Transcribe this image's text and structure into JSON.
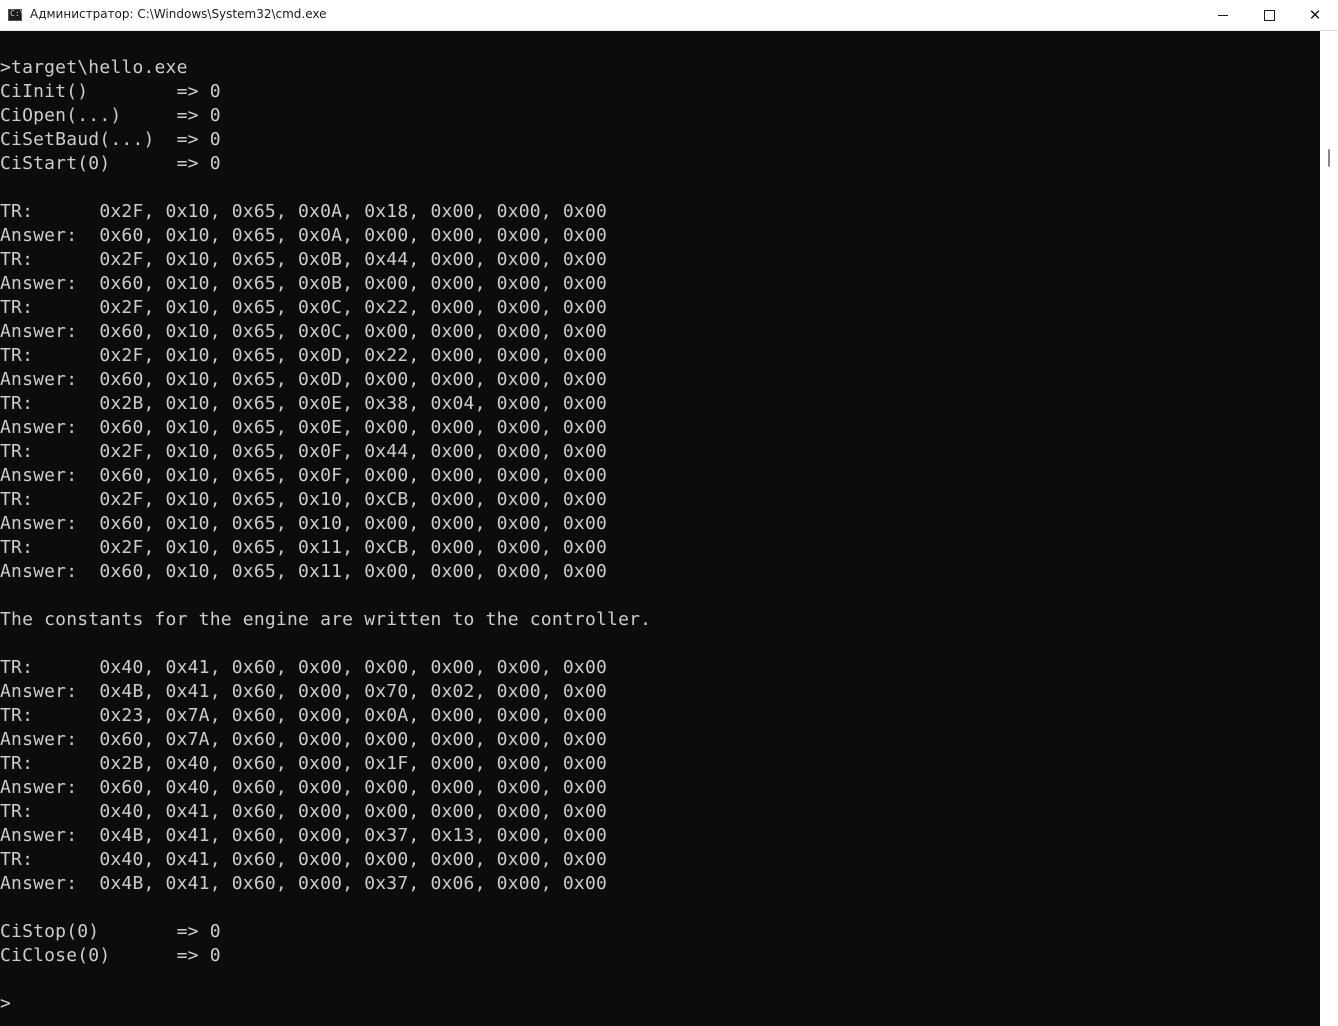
{
  "window": {
    "title": "Администратор: C:\\Windows\\System32\\cmd.exe",
    "app_icon": "cmd-prompt-icon",
    "prompt_glyph": "C:\\",
    "controls": {
      "minimize": "minimize-icon",
      "maximize": "maximize-icon",
      "close": "close-icon",
      "close_glyph": "✕"
    }
  },
  "console": {
    "lines": [
      "",
      ">target\\hello.exe",
      "CiInit()        => 0",
      "CiOpen(...)     => 0",
      "CiSetBaud(...)  => 0",
      "CiStart(0)      => 0",
      "",
      "TR:      0x2F, 0x10, 0x65, 0x0A, 0x18, 0x00, 0x00, 0x00",
      "Answer:  0x60, 0x10, 0x65, 0x0A, 0x00, 0x00, 0x00, 0x00",
      "TR:      0x2F, 0x10, 0x65, 0x0B, 0x44, 0x00, 0x00, 0x00",
      "Answer:  0x60, 0x10, 0x65, 0x0B, 0x00, 0x00, 0x00, 0x00",
      "TR:      0x2F, 0x10, 0x65, 0x0C, 0x22, 0x00, 0x00, 0x00",
      "Answer:  0x60, 0x10, 0x65, 0x0C, 0x00, 0x00, 0x00, 0x00",
      "TR:      0x2F, 0x10, 0x65, 0x0D, 0x22, 0x00, 0x00, 0x00",
      "Answer:  0x60, 0x10, 0x65, 0x0D, 0x00, 0x00, 0x00, 0x00",
      "TR:      0x2B, 0x10, 0x65, 0x0E, 0x38, 0x04, 0x00, 0x00",
      "Answer:  0x60, 0x10, 0x65, 0x0E, 0x00, 0x00, 0x00, 0x00",
      "TR:      0x2F, 0x10, 0x65, 0x0F, 0x44, 0x00, 0x00, 0x00",
      "Answer:  0x60, 0x10, 0x65, 0x0F, 0x00, 0x00, 0x00, 0x00",
      "TR:      0x2F, 0x10, 0x65, 0x10, 0xCB, 0x00, 0x00, 0x00",
      "Answer:  0x60, 0x10, 0x65, 0x10, 0x00, 0x00, 0x00, 0x00",
      "TR:      0x2F, 0x10, 0x65, 0x11, 0xCB, 0x00, 0x00, 0x00",
      "Answer:  0x60, 0x10, 0x65, 0x11, 0x00, 0x00, 0x00, 0x00",
      "",
      "The constants for the engine are written to the controller.",
      "",
      "TR:      0x40, 0x41, 0x60, 0x00, 0x00, 0x00, 0x00, 0x00",
      "Answer:  0x4B, 0x41, 0x60, 0x00, 0x70, 0x02, 0x00, 0x00",
      "TR:      0x23, 0x7A, 0x60, 0x00, 0x0A, 0x00, 0x00, 0x00",
      "Answer:  0x60, 0x7A, 0x60, 0x00, 0x00, 0x00, 0x00, 0x00",
      "TR:      0x2B, 0x40, 0x60, 0x00, 0x1F, 0x00, 0x00, 0x00",
      "Answer:  0x60, 0x40, 0x60, 0x00, 0x00, 0x00, 0x00, 0x00",
      "TR:      0x40, 0x41, 0x60, 0x00, 0x00, 0x00, 0x00, 0x00",
      "Answer:  0x4B, 0x41, 0x60, 0x00, 0x37, 0x13, 0x00, 0x00",
      "TR:      0x40, 0x41, 0x60, 0x00, 0x00, 0x00, 0x00, 0x00",
      "Answer:  0x4B, 0x41, 0x60, 0x00, 0x37, 0x06, 0x00, 0x00",
      "",
      "CiStop(0)       => 0",
      "CiClose(0)      => 0",
      "",
      ">"
    ]
  },
  "colors": {
    "background": "#0c0c0c",
    "text": "#cccccc",
    "titlebar": "#ffffff"
  }
}
